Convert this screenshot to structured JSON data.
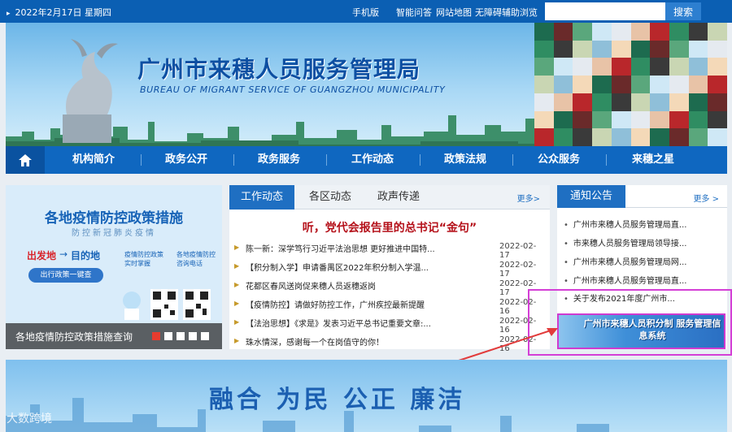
{
  "topbar": {
    "date": "2022年2月17日 星期四",
    "links": [
      "手机版",
      "智能问答",
      "网站地图",
      "无障碍辅助浏览"
    ],
    "search_placeholder": "",
    "search_label": "搜索"
  },
  "banner": {
    "title_cn": "广州市来穗人员服务管理局",
    "title_en": "BUREAU OF MIGRANT SERVICE OF GUANGZHOU MUNICIPALITY"
  },
  "nav": {
    "items": [
      "机构简介",
      "政务公开",
      "政务服务",
      "工作动态",
      "政策法规",
      "公众服务",
      "来穗之星"
    ]
  },
  "promo": {
    "title": "各地疫情防控政策措施",
    "subtitle": "防控新冠肺炎疫情",
    "caption": "各地疫情防控政策措施查询",
    "small_labels": [
      "出发地",
      "目的地",
      "出行政策一键查",
      "疫情防控政策实时掌握",
      "各地疫情防控咨询电话"
    ]
  },
  "news": {
    "tabs": [
      "工作动态",
      "各区动态",
      "政声传递"
    ],
    "more": "更多>",
    "headline": "听，党代会报告里的总书记“金句”",
    "items": [
      {
        "title": "陈一新：深学笃行习近平法治思想 更好推进中国特...",
        "date": "2022-02-17"
      },
      {
        "title": "【积分制入学】申请番禺区2022年积分制入学温...",
        "date": "2022-02-17"
      },
      {
        "title": "花都区春风送岗促来穗人员返穗返岗",
        "date": "2022-02-17"
      },
      {
        "title": "【疫情防控】请做好防控工作，广州疾控最新提醒",
        "date": "2022-02-16"
      },
      {
        "title": "【法治思想】《求是》发表习近平总书记重要文章:...",
        "date": "2022-02-16"
      },
      {
        "title": "珠水情深，感谢每一个在岗值守的你！",
        "date": "2022-02-16"
      }
    ]
  },
  "notice": {
    "title": "通知公告",
    "more": "更多 >",
    "items": [
      "广州市来穗人员服务管理局直...",
      "市来穗人员服务管理局领导接...",
      "广州市来穗人员服务管理局网...",
      "广州市来穗人员服务管理局直...",
      "关于发布2021年度广州市..."
    ],
    "points_banner": "广州市来穗人员积分制 服务管理信息系统"
  },
  "bottom": {
    "slogan": "融合 为民 公正 廉洁"
  },
  "watermark": "大数跨境",
  "colors": {
    "topbar": "#0b5fb3",
    "nav": "#0f67c0",
    "accent": "#1f6fc2",
    "headline_red": "#b5121b",
    "callout_magenta": "#d43fd6"
  }
}
